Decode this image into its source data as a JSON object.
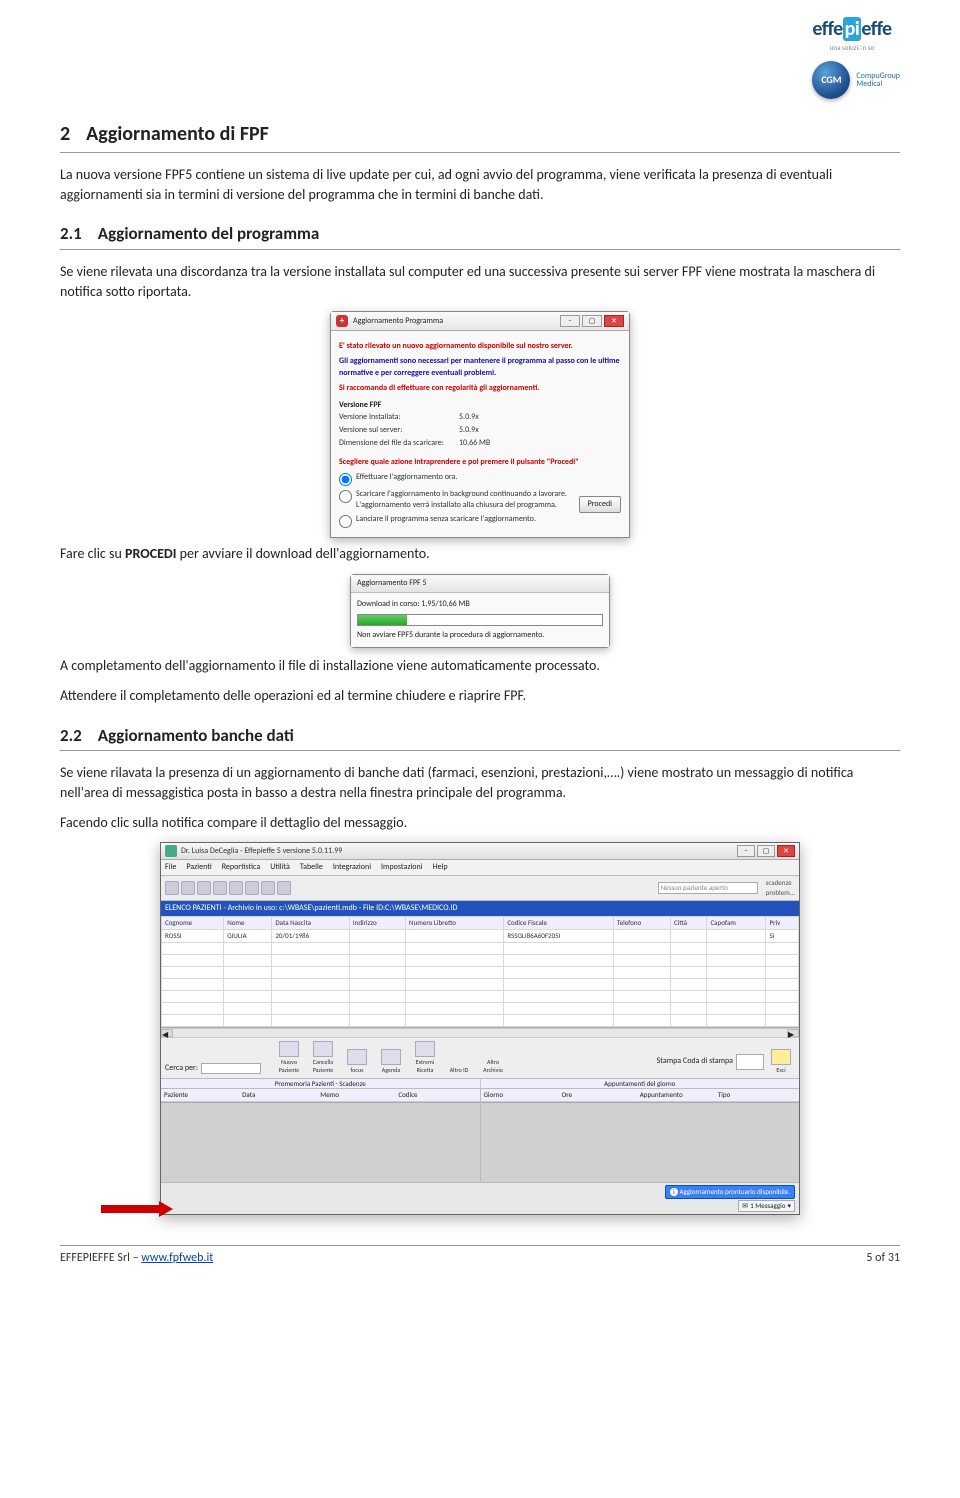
{
  "logos": {
    "effepieffe": "effepieffe",
    "pi": "pi",
    "effe_sub": "una soluzi∴n so",
    "cgm_badge": "CGM",
    "cgm_txt1": "CompuGroup",
    "cgm_txt2": "Medical"
  },
  "sec2": {
    "num": "2",
    "title": "Aggiornamento di FPF"
  },
  "p1": "La nuova versione FPF5 contiene un sistema di live update per cui, ad ogni avvio del programma, viene verificata la presenza di eventuali aggiornamenti sia in termini di versione del programma che in termini di banche dati.",
  "sec21": {
    "num": "2.1",
    "title": "Aggiornamento del programma"
  },
  "p2": "Se viene rilevata una discordanza tra la versione installata sul computer ed una successiva presente sui server FPF viene mostrata la maschera di notifica sotto riportata.",
  "dlg1": {
    "title": "Aggiornamento Programma",
    "line_red1": "E' stato rilevato un nuovo aggiornamento disponibile sul nostro server.",
    "line_blue1": "Gli aggiornamenti sono necessari per mantenere il programma al passo con le ultime normative e per correggere eventuali problemi.",
    "line_red2": "Si raccomanda di effettuare con regolarità gli aggiornamenti.",
    "grp": "Versione FPF",
    "k1": "Versione Installata:",
    "v1": "5.0.9x",
    "k2": "Versione sul server:",
    "v2": "5.0.9x",
    "k3": "Dimensione del file da scaricare:",
    "v3": "10,66 MB",
    "choose": "Scegliere quale azione intraprendere e poi premere il pulsante \"Procedi\"",
    "r1": "Effettuare l'aggiornamento ora.",
    "r2": "Scaricare l'aggiornamento in background continuando a lavorare. L'aggiornamento verrà installato alla chiusura del programma.",
    "r3": "Lanciare il programma senza scaricare l'aggiornamento.",
    "procedi": "Procedi"
  },
  "p3a": "Fare clic su ",
  "p3b": "PROCEDI",
  "p3c": " per avviare il download dell'aggiornamento.",
  "dlg2": {
    "title": "Aggiornamento FPF 5",
    "progress": "Download in corso:   1,95/10,66 MB",
    "note": "Non avviare FPF5 durante la procedura di aggiornamento."
  },
  "p4": "A completamento dell'aggiornamento il file di installazione viene automaticamente processato.",
  "p5": "Attendere il completamento delle operazioni ed al termine chiudere e riaprire FPF.",
  "sec22": {
    "num": "2.2",
    "title": "Aggiornamento banche dati"
  },
  "p6": "Se viene rilavata la presenza di un aggiornamento di banche dati (farmaci, esenzioni, prestazioni,….) viene mostrato un messaggio di notifica nell'area di messaggistica posta in basso a destra nella finestra principale del programma.",
  "p7": "Facendo clic sulla notifica compare il dettaglio del messaggio.",
  "app": {
    "title": "Dr. Luisa DeCeglia - Effepieffe 5 versione 5.0.11.99",
    "menu": [
      "File",
      "Pazienti",
      "Reportistica",
      "Utilità",
      "Tabelle",
      "Integrazioni",
      "Impostazioni",
      "Help"
    ],
    "no_patient": "Nessun paziente aperto",
    "side1": "scadenze",
    "side2": "problem...",
    "bluebar": "ELENCO PAZIENTI - Archivio in uso: c:\\WBASE\\pazienti.mdb - File ID:C:\\WBASE\\MEDICO.ID",
    "cols": [
      "Cognome",
      "Nome",
      "Data Nascita",
      "Indirizzo",
      "Numero Libretto",
      "Codice Fiscale",
      "Telefono",
      "Città",
      "Capofam",
      "Priv"
    ],
    "row": [
      "ROSSI",
      "GIULIA",
      "20/01/1986",
      "",
      "",
      "RSSGLI86A60F205I",
      "",
      "",
      "",
      "Sì"
    ],
    "cerca": "Cerca per:",
    "mbtns": [
      "Nuovo Paziente",
      "Cancella Paziente",
      "focus",
      "Agenda",
      "Estremi Ricetta"
    ],
    "altro_id": "Altro ID",
    "altro_arch": "Altro Archivio",
    "stampa": "Stampa Coda di stampa",
    "esci": "Esci",
    "left_hdr_title": "Promemoria Pazienti - Scadenze",
    "left_hdr": [
      "Paziente",
      "Data",
      "Memo",
      "Codice"
    ],
    "right_hdr_title": "Appuntamenti del giorno",
    "right_hdr": [
      "Giorno",
      "Ore",
      "Appuntamento",
      "Tipo"
    ],
    "notif": "Aggiornamento prontuario disponibile.",
    "msg": "1 Messaggio"
  },
  "footer": {
    "left1": "EFFEPIEFFE Srl – ",
    "link": "www.fpfweb.it",
    "right": "5 of 31"
  }
}
